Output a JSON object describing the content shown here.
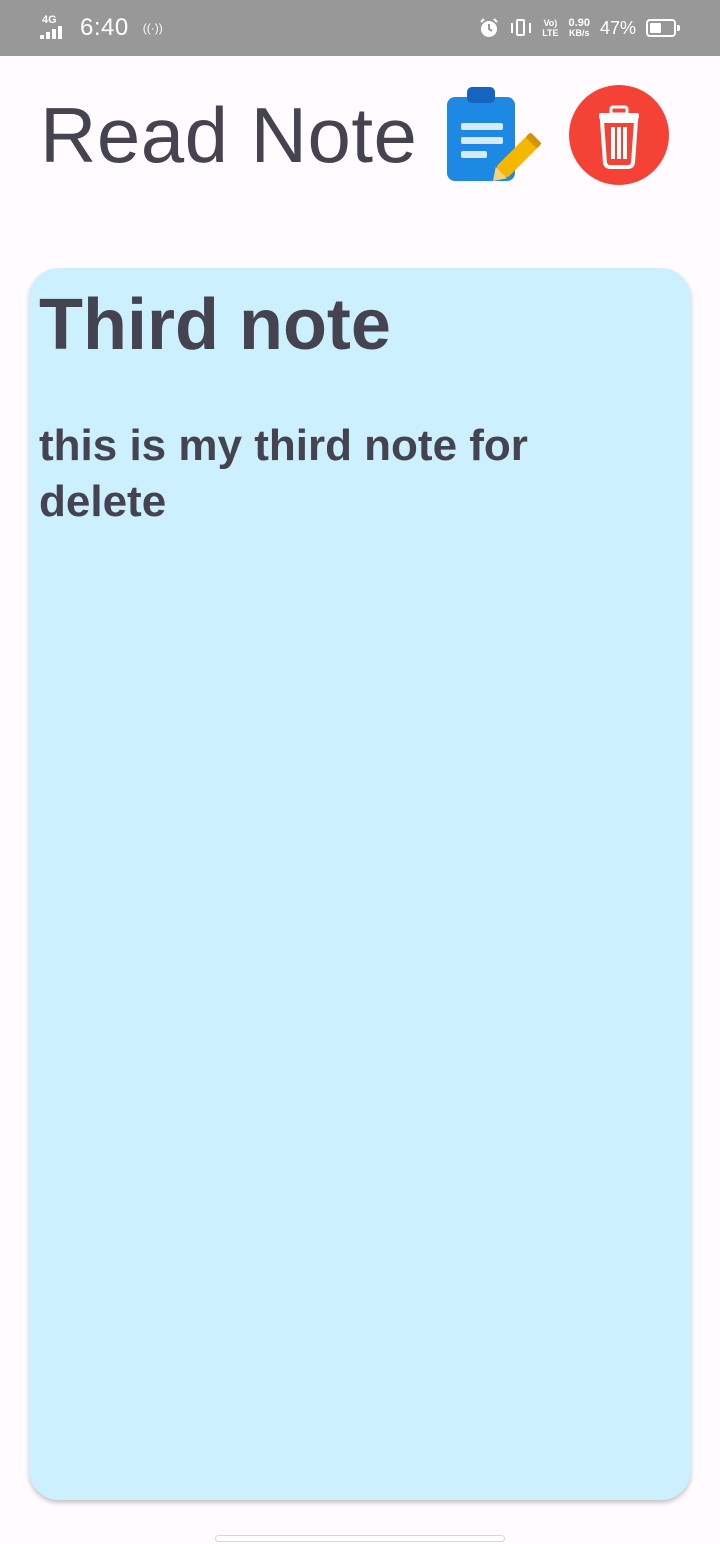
{
  "status_bar": {
    "network": "4G",
    "time": "6:40",
    "hotspot": "((·))",
    "volte_top": "Vo)",
    "volte_bottom": "LTE",
    "speed_value": "0.90",
    "speed_unit": "KB/s",
    "battery_pct": "47%",
    "battery_level": 0.47
  },
  "header": {
    "title": "Read Note",
    "edit_icon": "clipboard-edit-icon",
    "delete_icon": "trash-icon"
  },
  "note": {
    "title": "Third note",
    "body": "this is my third note for delete",
    "background": "#ccf0fe"
  },
  "colors": {
    "text": "#44434f",
    "delete_red": "#f44336",
    "edit_blue": "#1e88e5",
    "pencil_yellow": "#f5b800"
  }
}
